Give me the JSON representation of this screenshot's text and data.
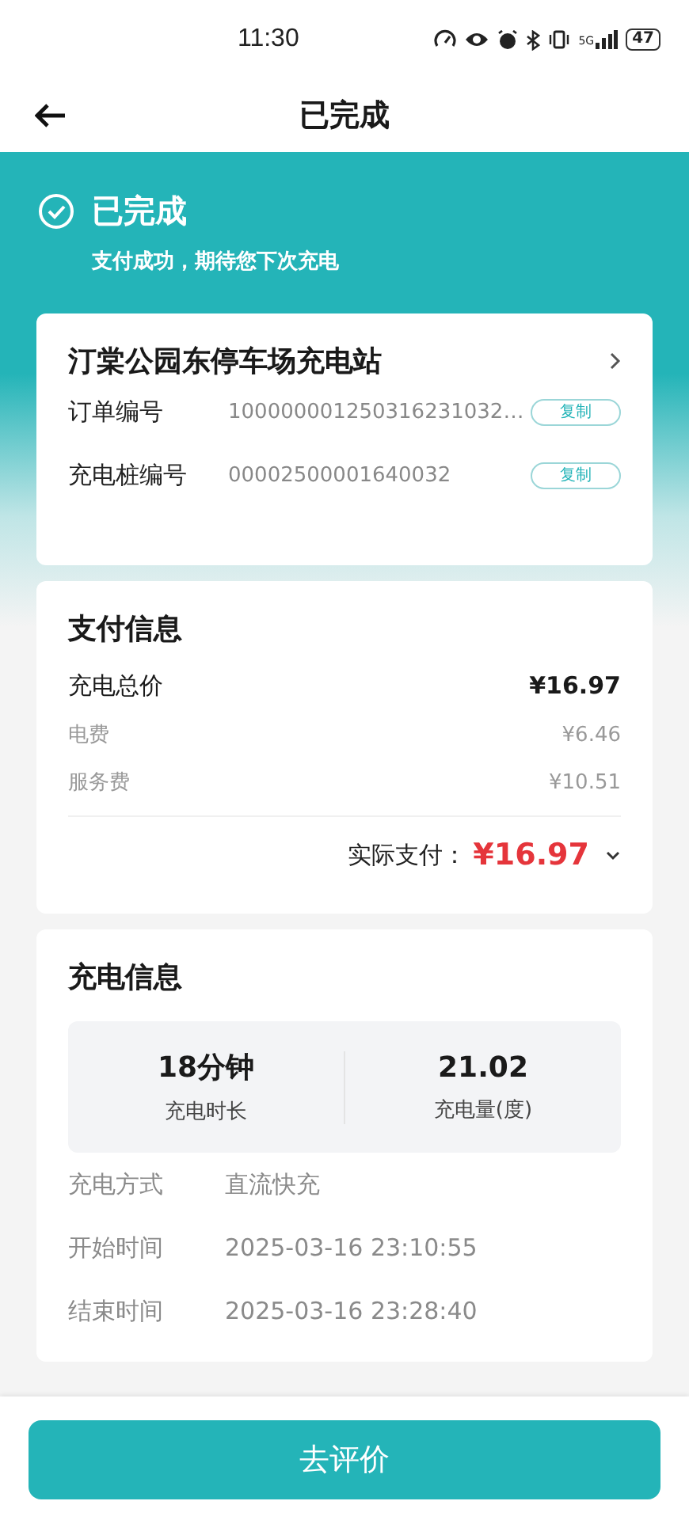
{
  "status_bar": {
    "time": "11:30",
    "network": "5G",
    "battery": "47"
  },
  "nav": {
    "title": "已完成"
  },
  "banner": {
    "status": "已完成",
    "message": "支付成功，期待您下次充电"
  },
  "station": {
    "name": "汀棠公园东停车场充电站",
    "fields": [
      {
        "label": "订单编号",
        "value": "100000001250316231032…",
        "action": "复制"
      },
      {
        "label": "充电桩编号",
        "value": "00002500001640032",
        "action": "复制"
      }
    ]
  },
  "payment": {
    "title": "支付信息",
    "total": {
      "label": "充电总价",
      "value": "¥16.97"
    },
    "items": [
      {
        "label": "电费",
        "value": "¥6.46"
      },
      {
        "label": "服务费",
        "value": "¥10.51"
      }
    ],
    "actual": {
      "label": "实际支付：",
      "value": "¥16.97"
    }
  },
  "charging": {
    "title": "充电信息",
    "stats": [
      {
        "value": "18分钟",
        "label": "充电时长"
      },
      {
        "value": "21.02",
        "label": "充电量(度)"
      }
    ],
    "details": [
      {
        "label": "充电方式",
        "value": "直流快充"
      },
      {
        "label": "开始时间",
        "value": "2025-03-16 23:10:55"
      },
      {
        "label": "结束时间",
        "value": "2025-03-16 23:28:40"
      }
    ]
  },
  "footer": {
    "button": "去评价"
  }
}
